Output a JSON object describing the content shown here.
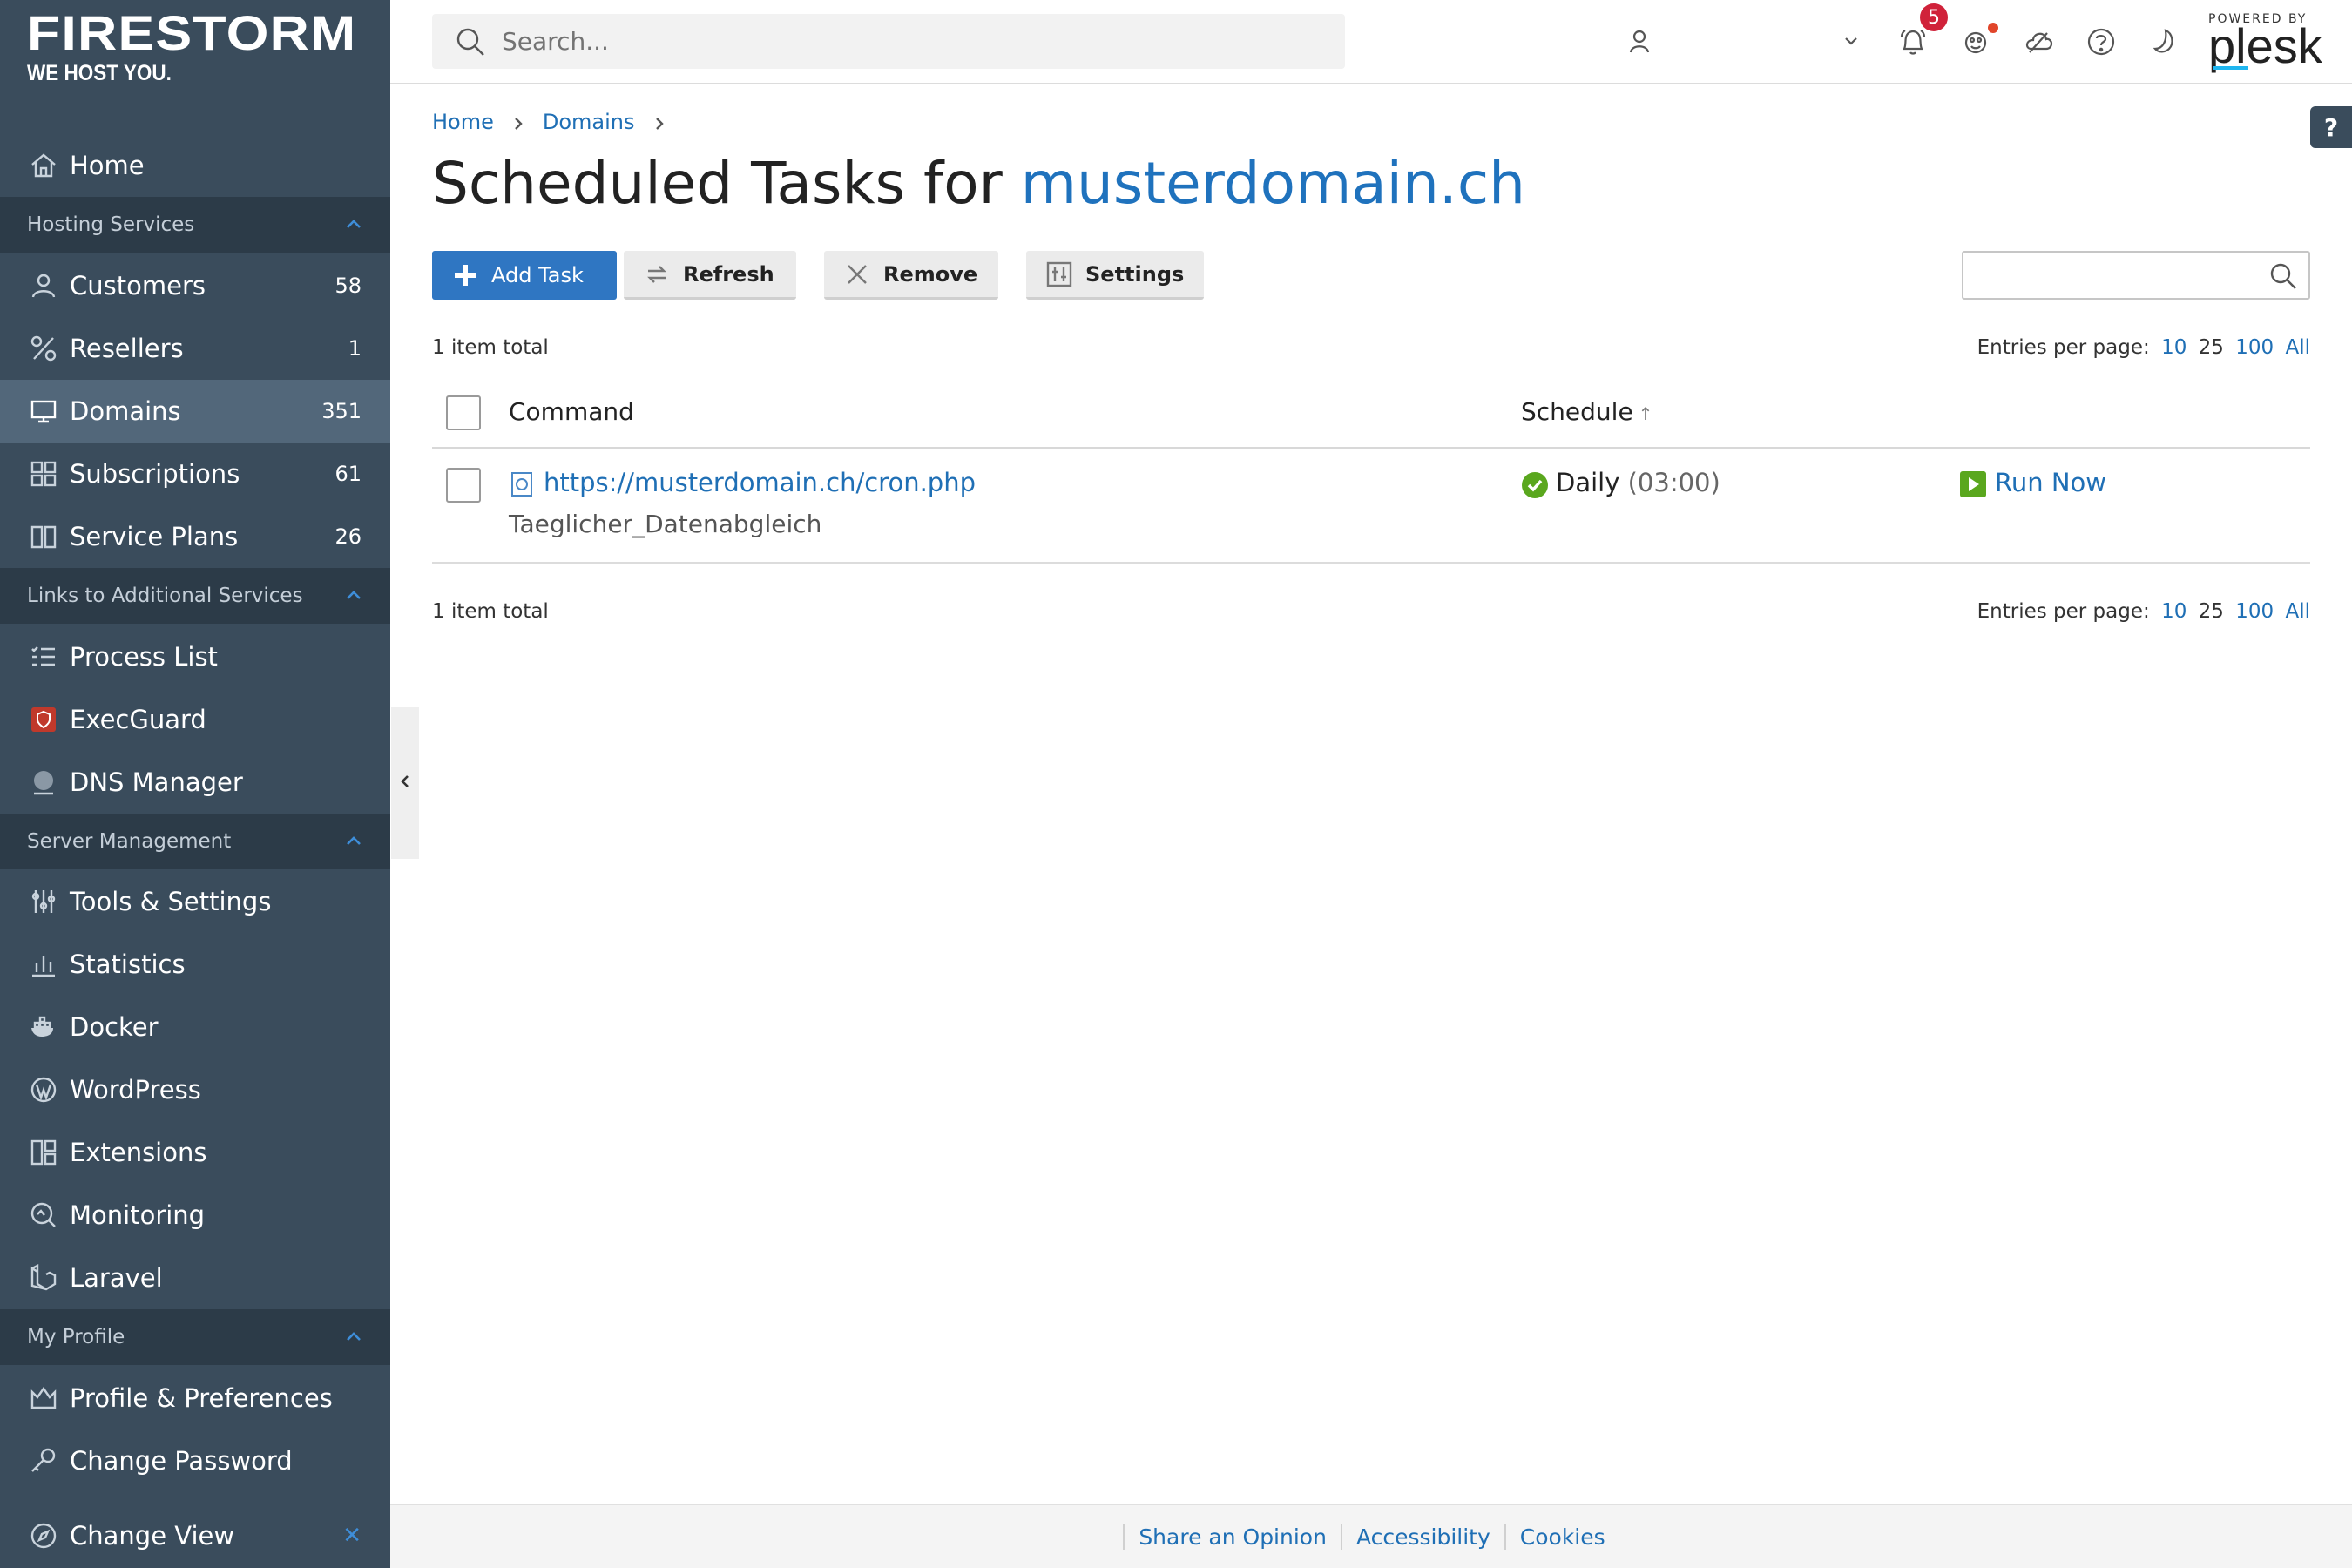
{
  "brand": {
    "name": "FIRESTORM",
    "tagline": "WE HOST YOU."
  },
  "sidebar": {
    "home": "Home",
    "hosting_group": "Hosting Services",
    "customers": {
      "label": "Customers",
      "count": "58"
    },
    "resellers": {
      "label": "Resellers",
      "count": "1"
    },
    "domains": {
      "label": "Domains",
      "count": "351"
    },
    "subscriptions": {
      "label": "Subscriptions",
      "count": "61"
    },
    "service_plans": {
      "label": "Service Plans",
      "count": "26"
    },
    "links_group": "Links to Additional Services",
    "process_list": "Process List",
    "execguard": "ExecGuard",
    "dns_manager": "DNS Manager",
    "server_group": "Server Management",
    "tools_settings": "Tools & Settings",
    "statistics": "Statistics",
    "docker": "Docker",
    "wordpress": "WordPress",
    "extensions": "Extensions",
    "monitoring": "Monitoring",
    "laravel": "Laravel",
    "profile_group": "My Profile",
    "profile_prefs": "Profile & Preferences",
    "change_password": "Change Password",
    "change_view": "Change View"
  },
  "topbar": {
    "search_placeholder": "Search...",
    "notification_count": "5",
    "powered_by": "POWERED BY",
    "plesk": "plesk"
  },
  "help_label": "?",
  "breadcrumb": {
    "home": "Home",
    "domains": "Domains"
  },
  "page": {
    "title_prefix": "Scheduled Tasks for ",
    "title_domain": "musterdomain.ch"
  },
  "toolbar": {
    "add_task": "Add Task",
    "refresh": "Refresh",
    "remove": "Remove",
    "settings": "Settings"
  },
  "list": {
    "total_text": "1 item total",
    "entries_label": "Entries per page:",
    "page_sizes": [
      "10",
      "25",
      "100",
      "All"
    ],
    "columns": {
      "command": "Command",
      "schedule": "Schedule",
      "sort_arrow": "↑"
    },
    "rows": [
      {
        "command": "https://musterdomain.ch/cron.php",
        "description": "Taeglicher_Datenabgleich",
        "schedule": "Daily",
        "time": "(03:00)",
        "action": "Run Now"
      }
    ]
  },
  "footer": {
    "share": "Share an Opinion",
    "accessibility": "Accessibility",
    "cookies": "Cookies"
  },
  "colors": {
    "sidebar": "#3a4c5c",
    "sidebar_group": "#2c3b48",
    "accent": "#2f76c2",
    "link": "#1f6fb5",
    "ok_green": "#5aa71e",
    "badge": "#d0223a"
  }
}
